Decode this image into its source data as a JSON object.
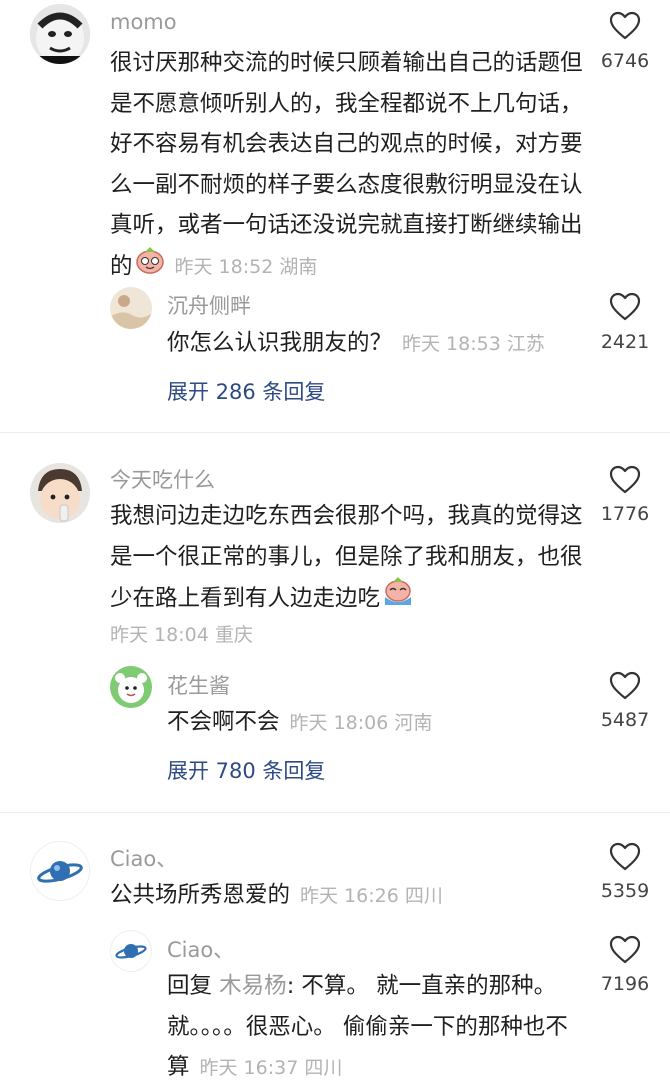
{
  "colors": {
    "link": "#2d4a84",
    "meta": "#b3b3b3",
    "name": "#9a9a9a",
    "text": "#1f1f1f"
  },
  "comments": [
    {
      "user": "momo",
      "text": "很讨厌那种交流的时候只顾着输出自己的话题但是不愿意倾听别人的，我全程都说不上几句话，好不容易有机会表达自己的观点的时候，对方要么一副不耐烦的样子要么态度很敷衍明显没在认真听，或者一句话还没说完就直接打断继续输出的",
      "emoji": "cute-face-emoji",
      "time": "昨天 18:52 湖南",
      "likes": "6746",
      "reply": {
        "user": "沉舟侧畔",
        "text": "你怎么认识我朋友的？",
        "time": "昨天 18:53 江苏",
        "likes": "2421"
      },
      "expand": "展开 286 条回复"
    },
    {
      "user": "今天吃什么",
      "text": "我想问边走边吃东西会很那个吗，我真的觉得这是一个很正常的事儿，但是除了我和朋友，也很少在路上看到有人边走边吃",
      "emoji": "crying-face-emoji",
      "time": "昨天 18:04 重庆",
      "likes": "1776",
      "reply": {
        "user": "花生酱",
        "text": "不会啊不会",
        "time": "昨天 18:06 河南",
        "likes": "5487"
      },
      "expand": "展开 780 条回复"
    },
    {
      "user": "Ciao、",
      "text": "公共场所秀恩爱的",
      "time": "昨天 16:26 四川",
      "likes": "5359",
      "reply": {
        "user": "Ciao、",
        "prefix": "回复",
        "reply_to": "木易杨",
        "text": ": 不算。  就一直亲的那种。 就。。。。很恶心。 偷偷亲一下的那种也不算",
        "time": "昨天 16:37 四川",
        "likes": "7196"
      }
    }
  ]
}
